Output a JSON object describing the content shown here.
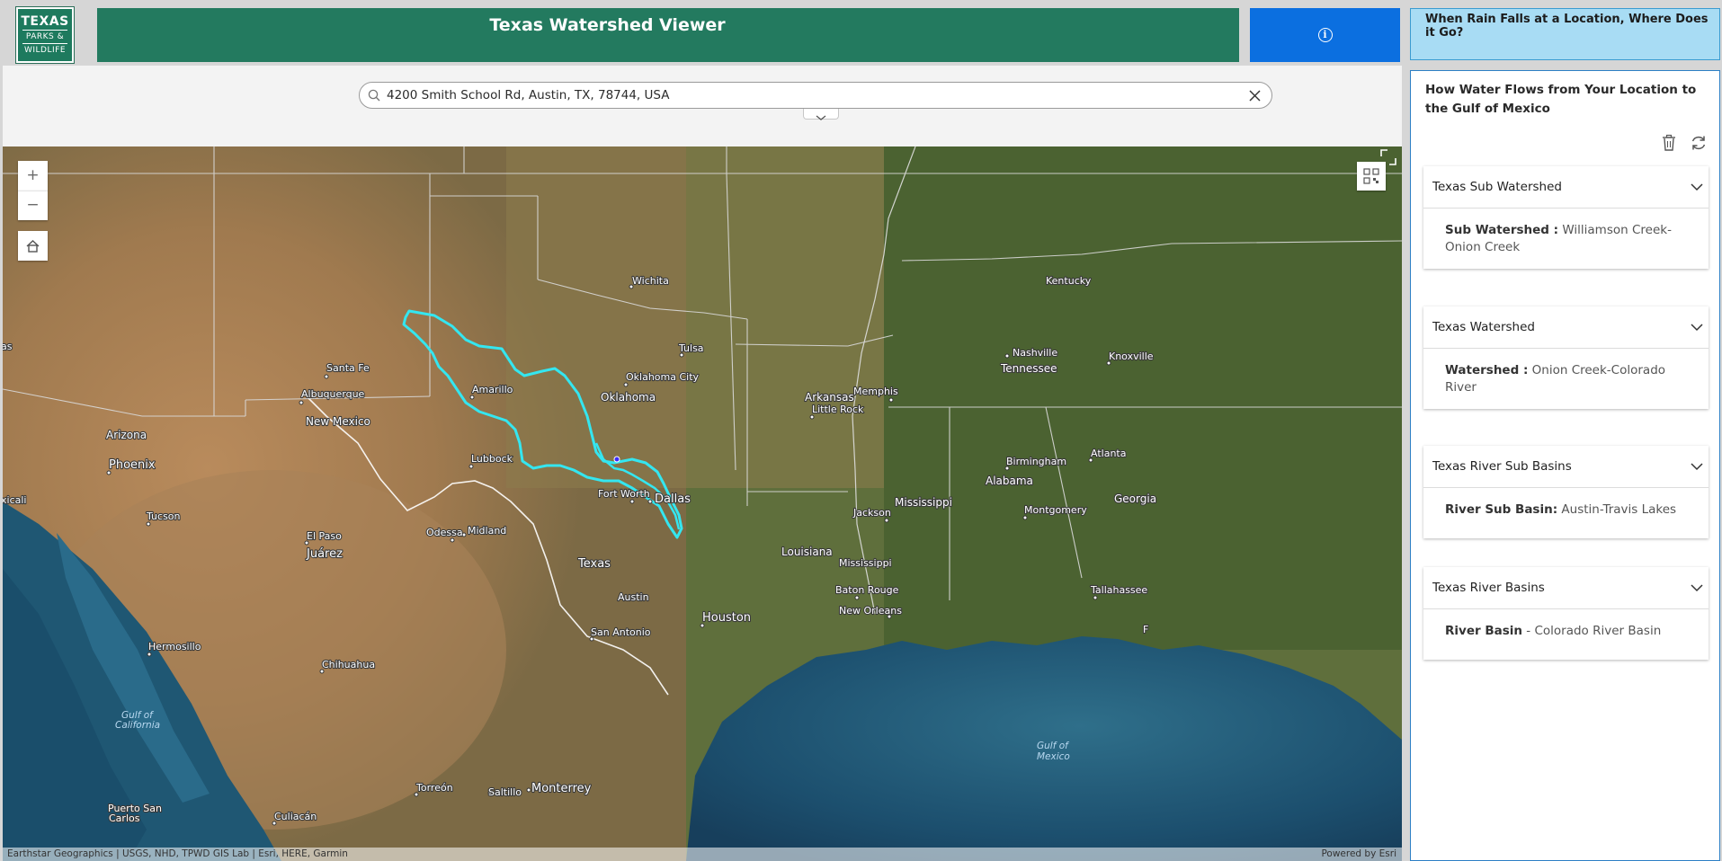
{
  "header": {
    "logo": {
      "line1": "TEXAS",
      "line2": "PARKS &",
      "line3": "WILDLIFE"
    },
    "title": "Texas Watershed Viewer",
    "info_icon": "info-icon"
  },
  "search": {
    "value": "4200 Smith School Rd, Austin, TX, 78744, USA",
    "search_icon": "search-icon",
    "clear_icon": "close-icon"
  },
  "map": {
    "controls": {
      "zoom_in": "+",
      "zoom_out": "−",
      "home_icon": "home-icon",
      "fullscreen_icon": "fullscreen-icon",
      "qr_icon": "qr-code-icon"
    },
    "labels": {
      "wichita": "Wichita",
      "kentucky": "Kentucky",
      "tulsa": "Tulsa",
      "nashville": "Nashville",
      "knoxville": "Knoxville",
      "tennessee": "Tennessee",
      "santafe": "Santa Fe",
      "albuquerque": "Albuquerque",
      "oklahoma_city": "Oklahoma City",
      "oklahoma": "Oklahoma",
      "amarillo": "Amarillo",
      "arkansas": "Arkansas",
      "memphis": "Memphis",
      "little_rock": "Little Rock",
      "new_mexico": "New Mexico",
      "arizona": "Arizona",
      "lubbock": "Lubbock",
      "atlanta": "Atlanta",
      "birmingham": "Birmingham",
      "phoenix": "Phoenix",
      "alabama": "Alabama",
      "mexicali": "xicali",
      "fort_worth": "Fort Worth",
      "dallas": "Dallas",
      "mississippi": "Mississippi",
      "georgia": "Georgia",
      "jackson": "Jackson",
      "montgomery": "Montgomery",
      "tucson": "Tucson",
      "odessa": "Odessa",
      "midland": "Midland",
      "el_paso": "El Paso",
      "juarez": "Juárez",
      "texas": "Texas",
      "louisiana": "Louisiana",
      "mississippi2": "Mississippi",
      "baton_rouge": "Baton Rouge",
      "tallahassee": "Tallahassee",
      "new_orleans": "New Orleans",
      "austin": "Austin",
      "houston": "Houston",
      "san_antonio": "San Antonio",
      "hermosillo": "Hermosillo",
      "chihuahua": "Chihuahua",
      "gulf_california_1": "Gulf of",
      "gulf_california_2": "California",
      "gulf_mexico_1": "Gulf of",
      "gulf_mexico_2": "Mexico",
      "torreon": "Torreón",
      "saltillo": "Saltillo",
      "monterrey": "Monterrey",
      "puerto_san_carlos_1": "Puerto San",
      "puerto_san_carlos_2": "Carlos",
      "culiacan": "Culiacán",
      "as_edge": "as",
      "f_edge": "F"
    },
    "attribution": "Earthstar Geographics | USGS, NHD, TPWD GIS Lab | Esri, HERE, Garmin",
    "powered_by": "Powered by Esri",
    "watershed_color": "#34e6f0"
  },
  "panel": {
    "header": "When Rain Falls at a Location, Where Does it Go?",
    "title": "How Water Flows from Your Location to the Gulf of Mexico",
    "cards": [
      {
        "heading": "Texas Sub Watershed",
        "label": "Sub Watershed :",
        "value": " Williamson Creek-Onion Creek"
      },
      {
        "heading": "Texas Watershed",
        "label": "Watershed :",
        "value": " Onion Creek-Colorado River"
      },
      {
        "heading": "Texas River Sub Basins",
        "label": "River Sub Basin:",
        "value": " Austin-Travis Lakes"
      },
      {
        "heading": "Texas River Basins",
        "label": "River Basin",
        "value": " - Colorado River Basin"
      }
    ]
  },
  "colors": {
    "title_bar": "#237a5f",
    "info_bar": "#0b6fe0",
    "panel_header": "#a8dcf4"
  }
}
